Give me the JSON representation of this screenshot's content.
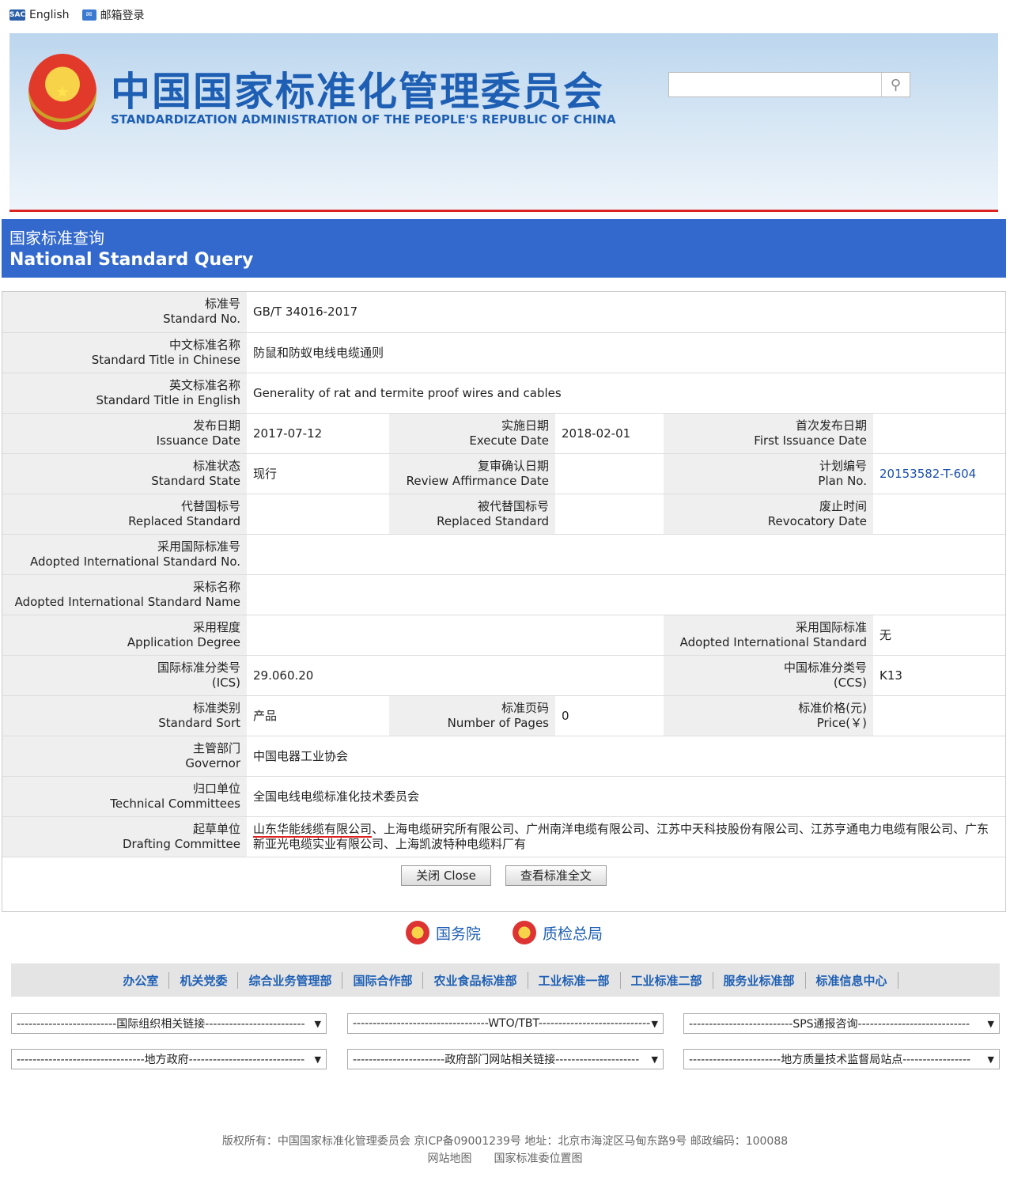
{
  "top": {
    "lang": "English",
    "mail": "邮箱登录"
  },
  "banner": {
    "cn": "中国国家标准化管理委员会",
    "en": "STANDARDIZATION ADMINISTRATION OF THE PEOPLE'S REPUBLIC OF CHINA"
  },
  "query": {
    "cn": "国家标准查询",
    "en": "National Standard Query"
  },
  "fields": {
    "std_no": [
      "标准号",
      "Standard No.",
      "GB/T 34016-2017"
    ],
    "title_cn": [
      "中文标准名称",
      "Standard Title in Chinese",
      "防鼠和防蚁电线电缆通则"
    ],
    "title_en": [
      "英文标准名称",
      "Standard Title in English",
      "Generality of rat and termite proof wires and cables"
    ],
    "issue": [
      "发布日期",
      "Issuance Date",
      "2017-07-12"
    ],
    "exec": [
      "实施日期",
      "Execute Date",
      "2018-02-01"
    ],
    "first": [
      "首次发布日期",
      "First Issuance Date",
      ""
    ],
    "state": [
      "标准状态",
      "Standard State",
      "现行"
    ],
    "review": [
      "复审确认日期",
      "Review Affirmance Date",
      ""
    ],
    "plan": [
      "计划编号",
      "Plan No.",
      "20153582-T-604"
    ],
    "replaced": [
      "代替国标号",
      "Replaced Standard",
      ""
    ],
    "replaced_by": [
      "被代替国标号",
      "Replaced Standard",
      ""
    ],
    "revoc": [
      "废止时间",
      "Revocatory Date",
      ""
    ],
    "adopt_no": [
      "采用国际标准号",
      "Adopted International Standard No.",
      ""
    ],
    "adopt_name": [
      "采标名称",
      "Adopted International Standard Name",
      ""
    ],
    "degree": [
      "采用程度",
      "Application Degree",
      ""
    ],
    "adopt_std": [
      "采用国际标准",
      "Adopted International Standard",
      "无"
    ],
    "ics": [
      "国际标准分类号",
      "(ICS)",
      "29.060.20"
    ],
    "ccs": [
      "中国标准分类号",
      "(CCS)",
      "K13"
    ],
    "sort": [
      "标准类别",
      "Standard Sort",
      "产品"
    ],
    "pages": [
      "标准页码",
      "Number of Pages",
      "0"
    ],
    "price": [
      "标准价格(元)",
      "Price(￥)",
      ""
    ],
    "gov": [
      "主管部门",
      "Governor",
      "中国电器工业协会"
    ],
    "tc": [
      "归口单位",
      "Technical Committees",
      "全国电线电缆标准化技术委员会"
    ],
    "draft": [
      "起草单位",
      "Drafting Committee",
      "山东华能线缆有限公司",
      "、上海电缆研究所有限公司、广州南洋电缆有限公司、江苏中天科技股份有限公司、江苏亨通电力电缆有限公司、广东新亚光电缆实业有限公司、上海凯波特种电缆料厂有"
    ]
  },
  "buttons": {
    "close": "关闭  Close",
    "full": "查看标准全文"
  },
  "gov_links": [
    "国务院",
    "质检总局"
  ],
  "nav": [
    "办公室",
    "机关党委",
    "综合业务管理部",
    "国际合作部",
    "农业食品标准部",
    "工业标准一部",
    "工业标准二部",
    "服务业标准部",
    "标准信息中心"
  ],
  "selects": [
    "-------------------------国际组织相关链接-------------------------",
    "----------------------------------WTO/TBT----------------------------",
    "--------------------------SPS通报咨询----------------------------",
    "--------------------------------地方政府-----------------------------",
    "-----------------------政府部门网站相关链接---------------------",
    "-----------------------地方质量技术监督局站点-----------------"
  ],
  "footer": {
    "line1": "版权所有：中国国家标准化管理委员会   京ICP备09001239号   地址：北京市海淀区马甸东路9号       邮政编码：100088",
    "links": [
      "网站地图",
      "国家标准委位置图"
    ]
  }
}
